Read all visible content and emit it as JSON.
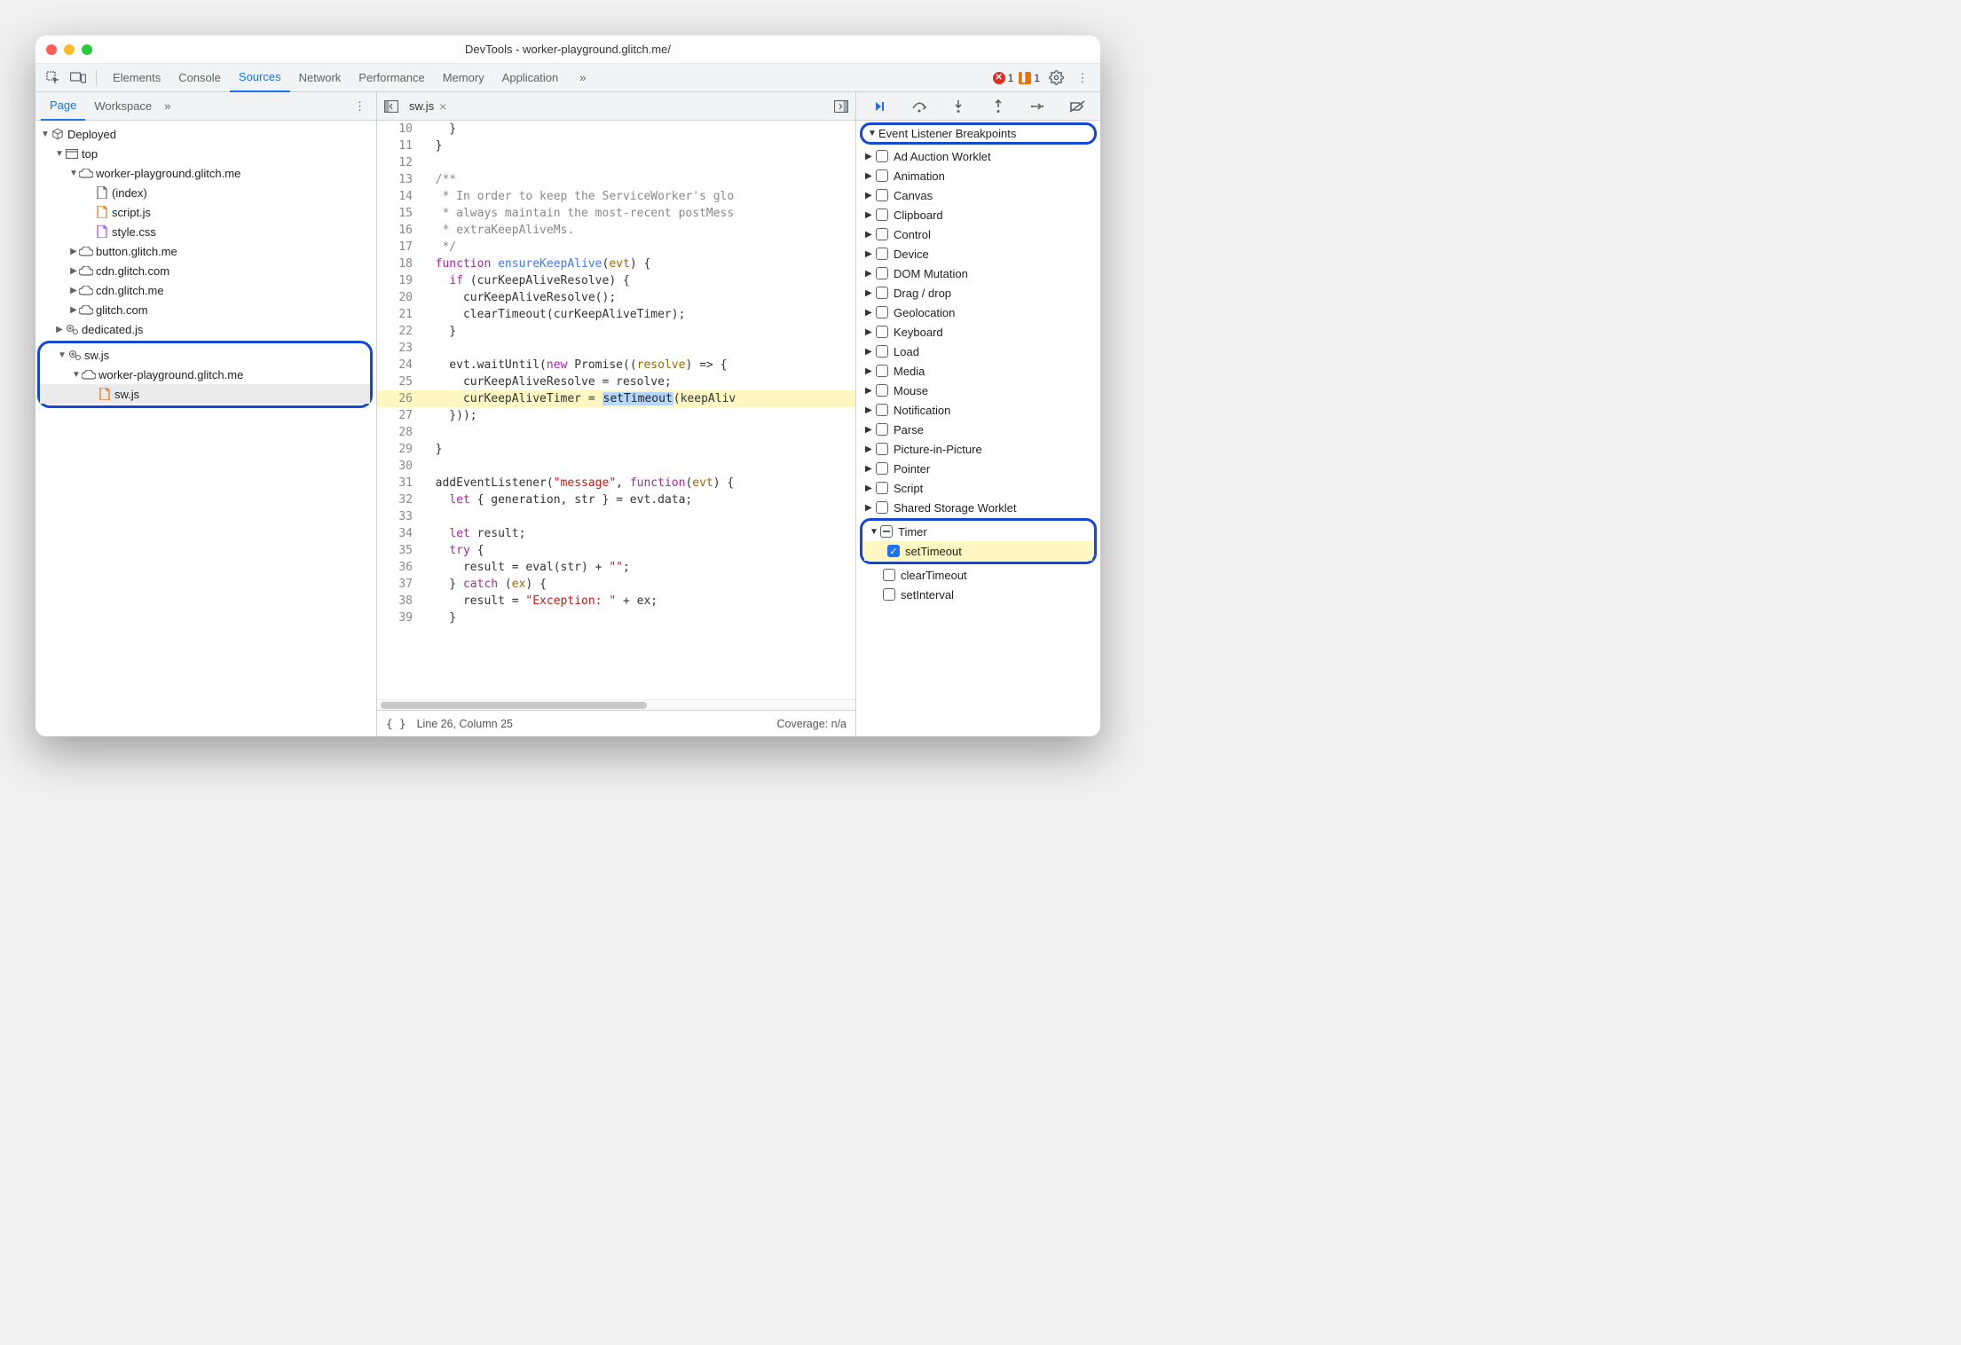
{
  "window": {
    "title": "DevTools - worker-playground.glitch.me/"
  },
  "toolbar": {
    "tabs": [
      "Elements",
      "Console",
      "Sources",
      "Network",
      "Performance",
      "Memory",
      "Application"
    ],
    "active": "Sources",
    "overflow": "»",
    "errors_count": "1",
    "warnings_count": "1"
  },
  "sidebar": {
    "tabs": {
      "page": "Page",
      "workspace": "Workspace",
      "overflow": "»"
    },
    "tree": {
      "deployed": "Deployed",
      "top": "top",
      "domain1": "worker-playground.glitch.me",
      "index": "(index)",
      "scriptjs": "script.js",
      "stylecss": "style.css",
      "button": "button.glitch.me",
      "cdn1": "cdn.glitch.com",
      "cdn2": "cdn.glitch.me",
      "glitch": "glitch.com",
      "dedicated": "dedicated.js",
      "swjs_group": "sw.js",
      "domain2": "worker-playground.glitch.me",
      "swjs_file": "sw.js"
    }
  },
  "editor": {
    "filename": "sw.js",
    "status": {
      "line_col": "Line 26, Column 25",
      "coverage": "Coverage: n/a"
    },
    "lines": [
      {
        "n": "10",
        "seg": [
          {
            "c": "tok-n",
            "t": "    }"
          }
        ]
      },
      {
        "n": "11",
        "seg": [
          {
            "c": "tok-n",
            "t": "  }"
          }
        ]
      },
      {
        "n": "12",
        "seg": [
          {
            "c": "tok-n",
            "t": ""
          }
        ]
      },
      {
        "n": "13",
        "seg": [
          {
            "c": "tok-c",
            "t": "  /**"
          }
        ]
      },
      {
        "n": "14",
        "seg": [
          {
            "c": "tok-c",
            "t": "   * In order to keep the ServiceWorker's glo"
          }
        ]
      },
      {
        "n": "15",
        "seg": [
          {
            "c": "tok-c",
            "t": "   * always maintain the most-recent postMess"
          }
        ]
      },
      {
        "n": "16",
        "seg": [
          {
            "c": "tok-c",
            "t": "   * extraKeepAliveMs."
          }
        ]
      },
      {
        "n": "17",
        "seg": [
          {
            "c": "tok-c",
            "t": "   */"
          }
        ]
      },
      {
        "n": "18",
        "seg": [
          {
            "c": "tok-k",
            "t": "  function "
          },
          {
            "c": "tok-f",
            "t": "ensureKeepAlive"
          },
          {
            "c": "tok-n",
            "t": "("
          },
          {
            "c": "tok-p",
            "t": "evt"
          },
          {
            "c": "tok-n",
            "t": ") {"
          }
        ]
      },
      {
        "n": "19",
        "seg": [
          {
            "c": "tok-n",
            "t": "    "
          },
          {
            "c": "tok-k",
            "t": "if"
          },
          {
            "c": "tok-n",
            "t": " (curKeepAliveResolve) {"
          }
        ]
      },
      {
        "n": "20",
        "seg": [
          {
            "c": "tok-n",
            "t": "      curKeepAliveResolve();"
          }
        ]
      },
      {
        "n": "21",
        "seg": [
          {
            "c": "tok-n",
            "t": "      clearTimeout(curKeepAliveTimer);"
          }
        ]
      },
      {
        "n": "22",
        "seg": [
          {
            "c": "tok-n",
            "t": "    }"
          }
        ]
      },
      {
        "n": "23",
        "seg": [
          {
            "c": "tok-n",
            "t": ""
          }
        ]
      },
      {
        "n": "24",
        "seg": [
          {
            "c": "tok-n",
            "t": "    evt.waitUntil("
          },
          {
            "c": "tok-k",
            "t": "new"
          },
          {
            "c": "tok-n",
            "t": " Promise(("
          },
          {
            "c": "tok-p",
            "t": "resolve"
          },
          {
            "c": "tok-n",
            "t": ") => {"
          }
        ]
      },
      {
        "n": "25",
        "seg": [
          {
            "c": "tok-n",
            "t": "      curKeepAliveResolve = resolve;"
          }
        ]
      },
      {
        "n": "26",
        "hl": true,
        "seg": [
          {
            "c": "tok-n",
            "t": "      curKeepAliveTimer = "
          },
          {
            "c": "tok-sel",
            "t": "setTimeout"
          },
          {
            "c": "tok-n",
            "t": "(keepAliv"
          }
        ]
      },
      {
        "n": "27",
        "seg": [
          {
            "c": "tok-n",
            "t": "    }));"
          }
        ]
      },
      {
        "n": "28",
        "seg": [
          {
            "c": "tok-n",
            "t": ""
          }
        ]
      },
      {
        "n": "29",
        "seg": [
          {
            "c": "tok-n",
            "t": "  }"
          }
        ]
      },
      {
        "n": "30",
        "seg": [
          {
            "c": "tok-n",
            "t": ""
          }
        ]
      },
      {
        "n": "31",
        "seg": [
          {
            "c": "tok-n",
            "t": "  addEventListener("
          },
          {
            "c": "tok-s",
            "t": "\"message\""
          },
          {
            "c": "tok-n",
            "t": ", "
          },
          {
            "c": "tok-k",
            "t": "function"
          },
          {
            "c": "tok-n",
            "t": "("
          },
          {
            "c": "tok-p",
            "t": "evt"
          },
          {
            "c": "tok-n",
            "t": ") {"
          }
        ]
      },
      {
        "n": "32",
        "seg": [
          {
            "c": "tok-n",
            "t": "    "
          },
          {
            "c": "tok-k",
            "t": "let"
          },
          {
            "c": "tok-n",
            "t": " { generation, str } = evt.data;"
          }
        ]
      },
      {
        "n": "33",
        "seg": [
          {
            "c": "tok-n",
            "t": ""
          }
        ]
      },
      {
        "n": "34",
        "seg": [
          {
            "c": "tok-n",
            "t": "    "
          },
          {
            "c": "tok-k",
            "t": "let"
          },
          {
            "c": "tok-n",
            "t": " result;"
          }
        ]
      },
      {
        "n": "35",
        "seg": [
          {
            "c": "tok-n",
            "t": "    "
          },
          {
            "c": "tok-k",
            "t": "try"
          },
          {
            "c": "tok-n",
            "t": " {"
          }
        ]
      },
      {
        "n": "36",
        "seg": [
          {
            "c": "tok-n",
            "t": "      result = eval(str) + "
          },
          {
            "c": "tok-s",
            "t": "\"\""
          },
          {
            "c": "tok-n",
            "t": ";"
          }
        ]
      },
      {
        "n": "37",
        "seg": [
          {
            "c": "tok-n",
            "t": "    } "
          },
          {
            "c": "tok-k",
            "t": "catch"
          },
          {
            "c": "tok-n",
            "t": " ("
          },
          {
            "c": "tok-p",
            "t": "ex"
          },
          {
            "c": "tok-n",
            "t": ") {"
          }
        ]
      },
      {
        "n": "38",
        "seg": [
          {
            "c": "tok-n",
            "t": "      result = "
          },
          {
            "c": "tok-s",
            "t": "\"Exception: \""
          },
          {
            "c": "tok-n",
            "t": " + ex;"
          }
        ]
      },
      {
        "n": "39",
        "seg": [
          {
            "c": "tok-n",
            "t": "    }"
          }
        ]
      }
    ]
  },
  "debugger": {
    "section_title": "Event Listener Breakpoints",
    "categories": [
      "Ad Auction Worklet",
      "Animation",
      "Canvas",
      "Clipboard",
      "Control",
      "Device",
      "DOM Mutation",
      "Drag / drop",
      "Geolocation",
      "Keyboard",
      "Load",
      "Media",
      "Mouse",
      "Notification",
      "Parse",
      "Picture-in-Picture",
      "Pointer",
      "Script",
      "Shared Storage Worklet"
    ],
    "timer": {
      "label": "Timer",
      "children": [
        {
          "label": "setTimeout",
          "checked": true
        },
        {
          "label": "clearTimeout",
          "checked": false
        },
        {
          "label": "setInterval",
          "checked": false
        }
      ]
    }
  }
}
